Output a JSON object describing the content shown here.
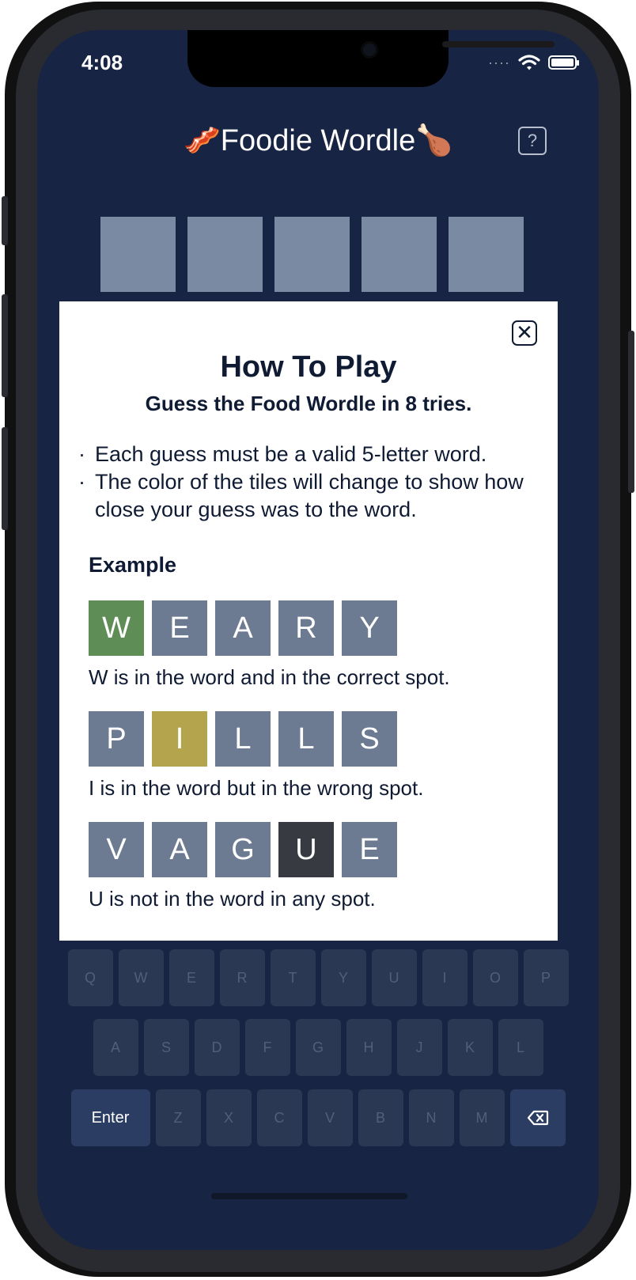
{
  "status_bar": {
    "time": "4:08",
    "signal": "····"
  },
  "header": {
    "title": "🥓Foodie Wordle🍗",
    "help_label": "?"
  },
  "board": {
    "tile_count": 5,
    "tile_color": "#7b8aa3"
  },
  "modal": {
    "close_label": "✕",
    "title": "How To Play",
    "subtitle": "Guess the Food Wordle in 8 tries.",
    "rules": [
      {
        "bullet": "·",
        "text": "Each guess must be a valid 5-letter word."
      },
      {
        "bullet": "·",
        "text": "The color of the tiles will change to show how close your guess was to the word."
      }
    ],
    "example_label": "Example",
    "examples": [
      {
        "tiles": [
          {
            "letter": "W",
            "color": "#5e8e56"
          },
          {
            "letter": "E",
            "color": "#6d7b92"
          },
          {
            "letter": "A",
            "color": "#6d7b92"
          },
          {
            "letter": "R",
            "color": "#6d7b92"
          },
          {
            "letter": "Y",
            "color": "#6d7b92"
          }
        ],
        "caption": "W is in the word and in the correct spot."
      },
      {
        "tiles": [
          {
            "letter": "P",
            "color": "#6d7b92"
          },
          {
            "letter": "I",
            "color": "#b4a44e"
          },
          {
            "letter": "L",
            "color": "#6d7b92"
          },
          {
            "letter": "L",
            "color": "#6d7b92"
          },
          {
            "letter": "S",
            "color": "#6d7b92"
          }
        ],
        "caption": "I is in the word but in the wrong spot."
      },
      {
        "tiles": [
          {
            "letter": "V",
            "color": "#6d7b92"
          },
          {
            "letter": "A",
            "color": "#6d7b92"
          },
          {
            "letter": "G",
            "color": "#6d7b92"
          },
          {
            "letter": "U",
            "color": "#373a40"
          },
          {
            "letter": "E",
            "color": "#6d7b92"
          }
        ],
        "caption": "U is not in the word in any spot."
      }
    ]
  },
  "keyboard": {
    "row1": [
      "Q",
      "W",
      "E",
      "R",
      "T",
      "Y",
      "U",
      "I",
      "O",
      "P"
    ],
    "row2": [
      "A",
      "S",
      "D",
      "F",
      "G",
      "H",
      "J",
      "K",
      "L"
    ],
    "row3": [
      "Z",
      "X",
      "C",
      "V",
      "B",
      "N",
      "M"
    ],
    "enter_label": "Enter",
    "delete_icon": "backspace-icon"
  },
  "colors": {
    "background": "#172443",
    "key": "#2b3853",
    "key_accent": "#2b3d63",
    "correct": "#5e8e56",
    "present": "#b4a44e",
    "absent": "#373a40",
    "neutral_tile": "#6d7b92"
  }
}
